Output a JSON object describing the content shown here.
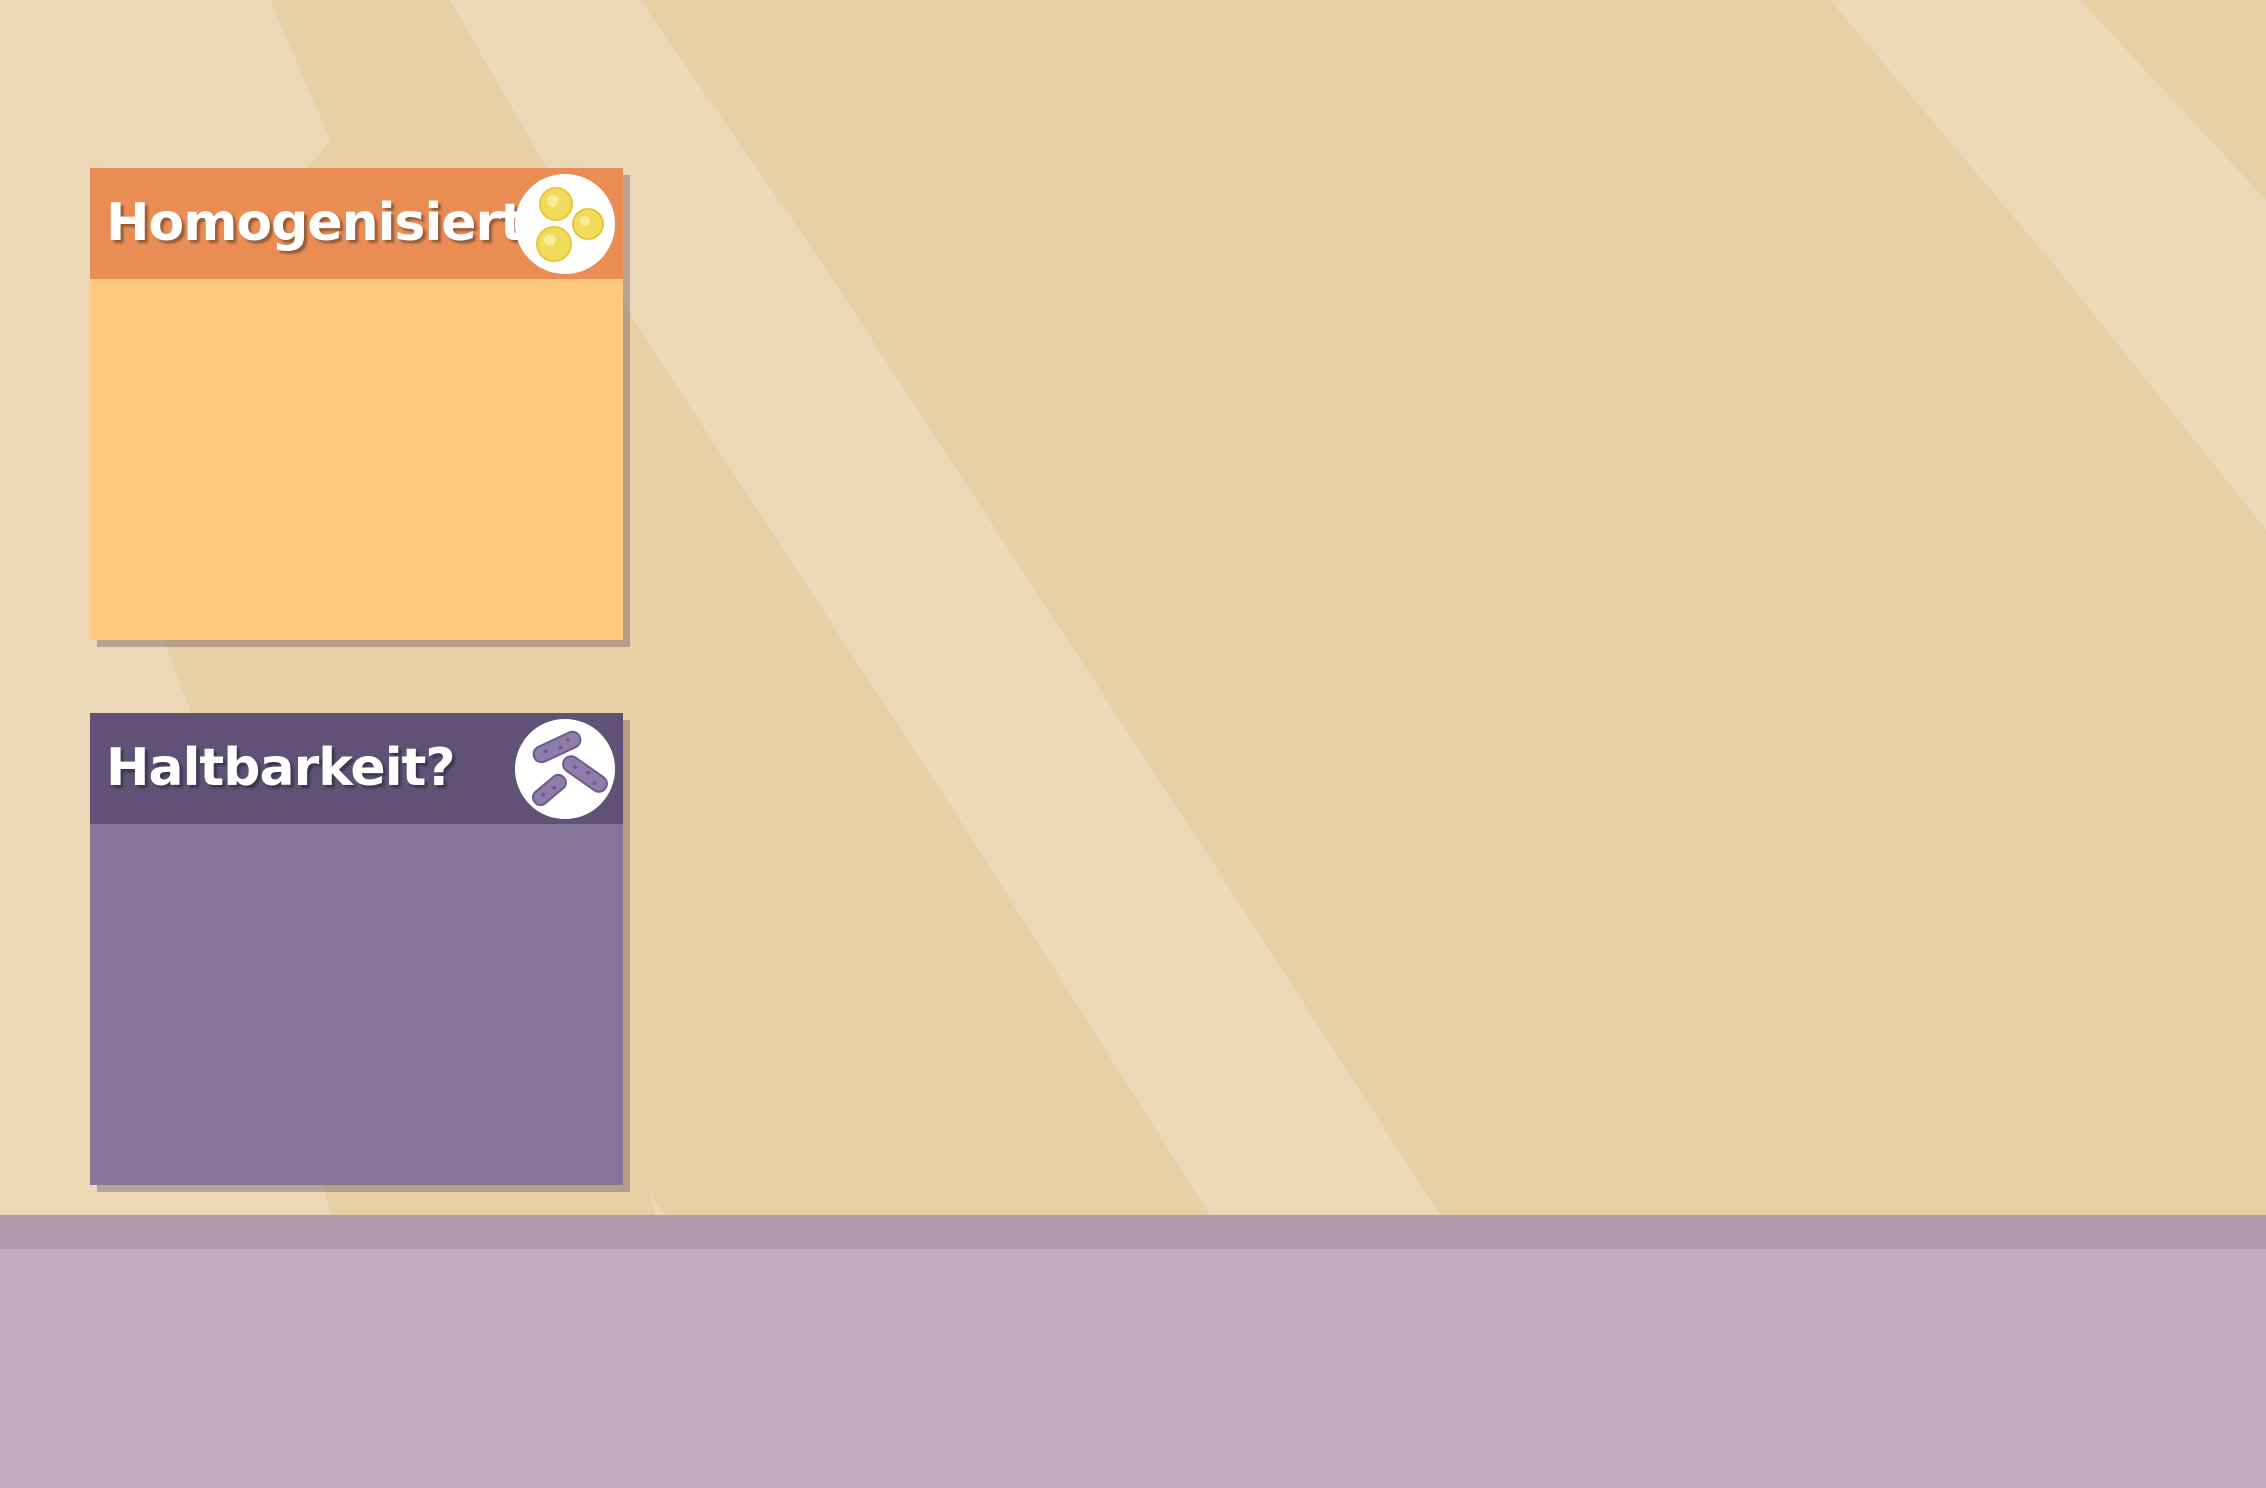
{
  "scene": {
    "background_color": "#e9cfa6",
    "light_stripe_color": "#ecd7b7",
    "floor_color": "#c2acbd",
    "floor_edge_color": "#b19aab"
  },
  "cards": [
    {
      "title": "Homogenisiert?",
      "icon": "fat-globules-icon",
      "header_color": "#e98d55",
      "body_color": "#fec97d"
    },
    {
      "title": "Haltbarkeit?",
      "icon": "bacteria-icon",
      "header_color": "#5f5276",
      "body_color": "#857799"
    }
  ]
}
